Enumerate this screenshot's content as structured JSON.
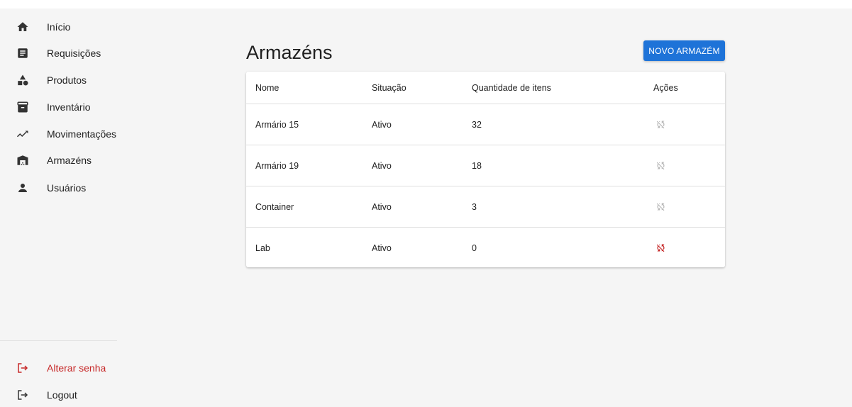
{
  "colors": {
    "accent": "#1e73d8",
    "danger": "#c62828",
    "icon_default": "#333333",
    "action_disabled": "#b8b8b8"
  },
  "sidebar": {
    "items": [
      {
        "label": "Início",
        "icon": "home-icon"
      },
      {
        "label": "Requisições",
        "icon": "document-icon"
      },
      {
        "label": "Produtos",
        "icon": "category-icon"
      },
      {
        "label": "Inventário",
        "icon": "archive-icon"
      },
      {
        "label": "Movimentações",
        "icon": "trending-icon"
      },
      {
        "label": "Armazéns",
        "icon": "warehouse-icon"
      },
      {
        "label": "Usuários",
        "icon": "person-icon"
      }
    ],
    "footer": [
      {
        "label": "Alterar senha",
        "icon": "logout-icon"
      },
      {
        "label": "Logout",
        "icon": "logout-icon"
      }
    ]
  },
  "main": {
    "title": "Armazéns",
    "new_button": "NOVO ARMAZÉM",
    "table": {
      "headers": [
        "Nome",
        "Situação",
        "Quantidade de itens",
        "Ações"
      ],
      "rows": [
        {
          "name": "Armário 15",
          "status": "Ativo",
          "qty": "32",
          "action": "sync-disabled-icon",
          "action_enabled": false
        },
        {
          "name": "Armário 19",
          "status": "Ativo",
          "qty": "18",
          "action": "sync-disabled-icon",
          "action_enabled": false
        },
        {
          "name": "Container",
          "status": "Ativo",
          "qty": "3",
          "action": "sync-disabled-icon",
          "action_enabled": false
        },
        {
          "name": "Lab",
          "status": "Ativo",
          "qty": "0",
          "action": "sync-disabled-icon",
          "action_enabled": true
        }
      ]
    }
  }
}
